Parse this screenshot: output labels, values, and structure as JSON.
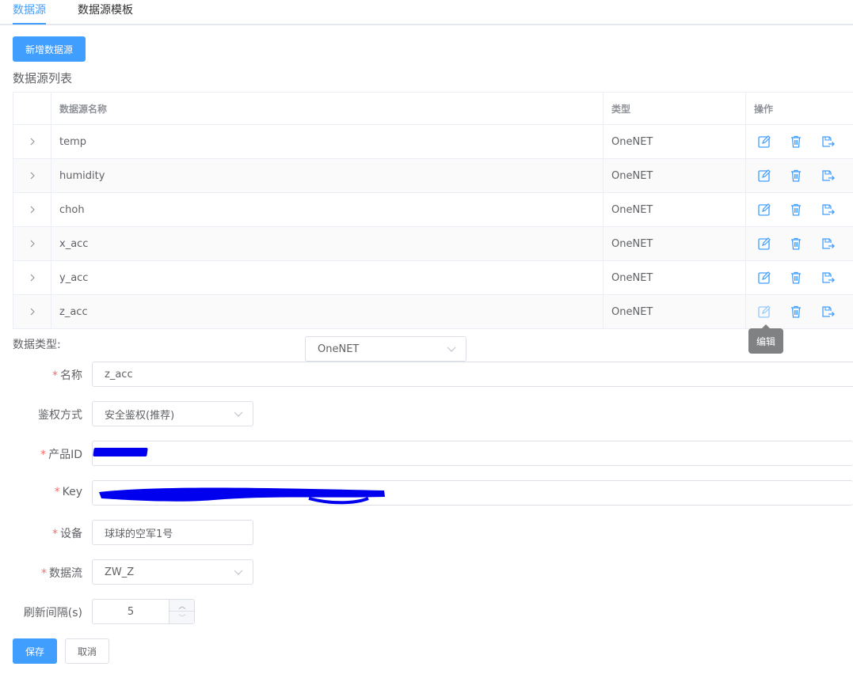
{
  "tabs": [
    {
      "label": "数据源",
      "active": true
    },
    {
      "label": "数据源模板",
      "active": false
    }
  ],
  "toolbar": {
    "add_label": "新增数据源"
  },
  "section_title": "数据源列表",
  "table": {
    "headers": {
      "name": "数据源名称",
      "type": "类型",
      "ops": "操作"
    },
    "rows": [
      {
        "name": "temp",
        "type": "OneNET"
      },
      {
        "name": "humidity",
        "type": "OneNET"
      },
      {
        "name": "choh",
        "type": "OneNET"
      },
      {
        "name": "x_acc",
        "type": "OneNET"
      },
      {
        "name": "y_acc",
        "type": "OneNET"
      },
      {
        "name": "z_acc",
        "type": "OneNET"
      }
    ],
    "op_icons": [
      "edit-icon",
      "delete-icon",
      "export-icon"
    ],
    "tooltip": "编辑"
  },
  "form": {
    "data_type_label": "数据类型:",
    "data_type_value": "OneNET",
    "name_label": "名称",
    "name_value": "z_acc",
    "auth_label": "鉴权方式",
    "auth_value": "安全鉴权(推荐)",
    "product_label": "产品ID",
    "key_label": "Key",
    "device_label": "设备",
    "device_value": "球球的空军1号",
    "stream_label": "数据流",
    "stream_value": "ZW_Z",
    "refresh_label": "刷新间隔(s)",
    "refresh_value": "5",
    "required_mark": "*"
  },
  "actions": {
    "save_label": "保存",
    "cancel_label": "取消"
  },
  "colors": {
    "primary": "#409eff",
    "required": "#f56c6c",
    "redaction": "#0000ee"
  }
}
